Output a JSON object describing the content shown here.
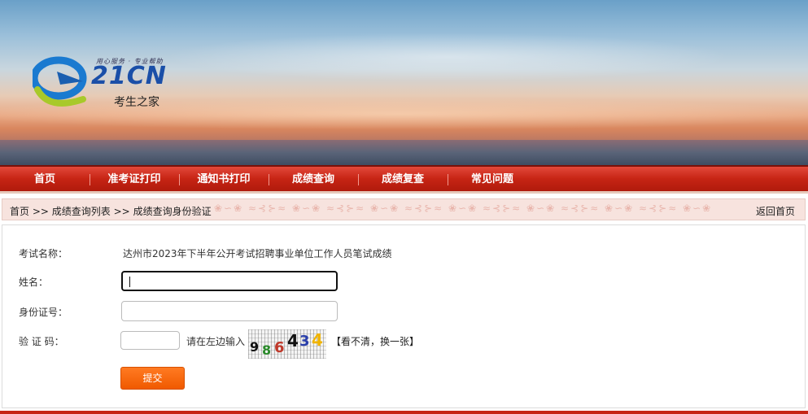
{
  "header": {
    "logo_slogan": "用心服务 · 专业帮助",
    "logo_brand": "21CN",
    "logo_subtitle": "考生之家"
  },
  "nav": {
    "items": [
      {
        "label": "首页"
      },
      {
        "label": "准考证打印"
      },
      {
        "label": "通知书打印"
      },
      {
        "label": "成绩查询"
      },
      {
        "label": "成绩复查"
      },
      {
        "label": "常见问题"
      }
    ]
  },
  "breadcrumb": {
    "home": "首页",
    "sep1": ">>",
    "list": "成绩查询列表",
    "sep2": ">>",
    "current": "成绩查询身份验证",
    "back": "返回首页"
  },
  "form": {
    "exam_label": "考试名称：",
    "exam_name": "达州市2023年下半年公开考试招聘事业单位工作人员笔试成绩",
    "name_label": "姓名：",
    "name_value": "",
    "id_label": "身份证号：",
    "id_value": "",
    "captcha_label": "验 证 码：",
    "captcha_value": "",
    "captcha_hint": "请在左边输入",
    "captcha_digits": [
      "9",
      "8",
      "6",
      "4",
      "3",
      "4"
    ],
    "captcha_colors": [
      "#111111",
      "#2a8a2a",
      "#c0392b",
      "#111111",
      "#2a3faa",
      "#f0b400"
    ],
    "refresh_label": "【看不清，换一张】",
    "submit_label": "提交"
  },
  "colors": {
    "nav_red": "#c62414",
    "submit_orange": "#f05a00",
    "logo_blue": "#1a4fa8",
    "logo_green": "#9ac42a"
  }
}
